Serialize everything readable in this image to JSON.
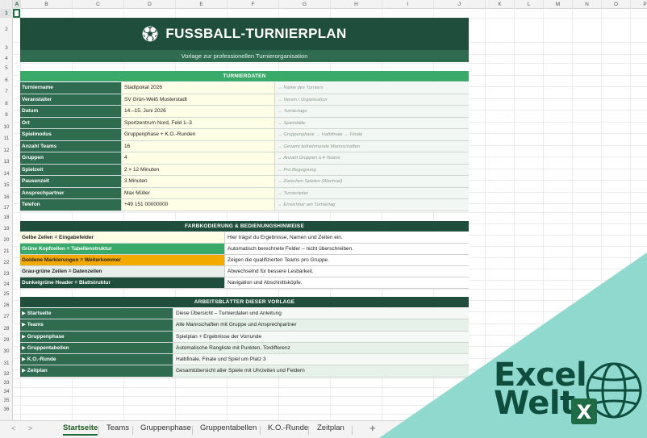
{
  "columns": [
    "A",
    "B",
    "C",
    "D",
    "E",
    "F",
    "G",
    "H",
    "I",
    "J",
    "K",
    "L",
    "M",
    "N",
    "O",
    "P"
  ],
  "rows": [
    "1",
    "2",
    "3",
    "4",
    "5",
    "6",
    "7",
    "8",
    "9",
    "10",
    "11",
    "12",
    "13",
    "14",
    "15",
    "16",
    "17",
    "18",
    "19",
    "20",
    "21",
    "22",
    "23",
    "24",
    "25",
    "26",
    "27",
    "28",
    "29",
    "30",
    "31",
    "32",
    "33",
    "34",
    "35",
    "36"
  ],
  "banner": {
    "title": "FUSSBALL-TURNIERPLAN",
    "subtitle": "Vorlage zur professionellen Turnierorganisation"
  },
  "turnierdaten": {
    "header": "TURNIERDATEN",
    "rows": [
      {
        "label": "Turniername",
        "value": "Stadtpokal 2026",
        "note": "→ Name des Turniers"
      },
      {
        "label": "Veranstalter",
        "value": "SV Grün-Weiß Musterstadt",
        "note": "→ Verein / Organisation"
      },
      {
        "label": "Datum",
        "value": "14.–15. Juni 2026",
        "note": "→ Turniertage"
      },
      {
        "label": "Ort",
        "value": "Sportzentrum Nord, Feld 1–3",
        "note": "→ Spielstätte"
      },
      {
        "label": "Spielmodus",
        "value": "Gruppenphase + K.O.-Runden",
        "note": "→ Gruppenphase → Halbfinale → Finale"
      },
      {
        "label": "Anzahl Teams",
        "value": "16",
        "note": "→ Gesamt teilnehmende Mannschaften"
      },
      {
        "label": "Gruppen",
        "value": "4",
        "note": "→ Anzahl Gruppen à 4 Teams"
      },
      {
        "label": "Spielzeit",
        "value": "2 × 12 Minuten",
        "note": "→ Pro Begegnung"
      },
      {
        "label": "Pausenzeit",
        "value": "3 Minuten",
        "note": "→ Zwischen Spielen (Wechsel)"
      },
      {
        "label": "Ansprechpartner",
        "value": "Max Müller",
        "note": "→ Turnierleiter"
      },
      {
        "label": "Telefon",
        "value": "+49 151 00000000",
        "note": "→ Erreichbar am Turniertag"
      }
    ]
  },
  "farbkodierung": {
    "header": "FARBKODIERUNG & BEDIENUNGSHINWEISE",
    "rows": [
      {
        "label": "Gelbe Zellen = Eingabefelder",
        "desc": "Hier trägst du Ergebnisse, Namen und Zeiten ein.",
        "bg": "#fefde6",
        "fg": "#222222"
      },
      {
        "label": "Grüne Kopfzeilen = Tabellenstruktur",
        "desc": "Automatisch berechnete Felder – nicht überschreiben.",
        "bg": "#3aaa6a",
        "fg": "#ffffff"
      },
      {
        "label": "Goldene Markierungen = Weiterkommer",
        "desc": "Zeigen die qualifizierten Teams pro Gruppe.",
        "bg": "#f2a900",
        "fg": "#222222"
      },
      {
        "label": "Grau-grüne Zeilen = Datenzeilen",
        "desc": "Abwechselnd für bessere Lesbarkeit.",
        "bg": "#e6efe9",
        "fg": "#222222"
      },
      {
        "label": "Dunkelgrüne Header = Blattstruktur",
        "desc": "Navigation und Abschnittsköpfe.",
        "bg": "#1f4e3d",
        "fg": "#ffffff"
      }
    ]
  },
  "arbeitsblaetter": {
    "header": "ARBEITSBLÄTTER DIESER VORLAGE",
    "rows": [
      {
        "label": "▶ Startseite",
        "desc": "Diese Übersicht – Turnierdaten und Anleitung"
      },
      {
        "label": "▶ Teams",
        "desc": "Alle Mannschaften mit Gruppe und Ansprechpartner"
      },
      {
        "label": "▶ Gruppenphase",
        "desc": "Spielplan + Ergebnisse der Vorrunde"
      },
      {
        "label": "▶ Gruppentabellen",
        "desc": "Automatische Rangliste mit Punkten, Tordifferenz"
      },
      {
        "label": "▶ K.O.-Runde",
        "desc": "Halbfinale, Finale und Spiel um Platz 3"
      },
      {
        "label": "▶ Zeitplan",
        "desc": "Gesamtübersicht aller Spiele mit Uhrzeiten und Feldern"
      }
    ]
  },
  "tabs": [
    "Startseite",
    "Teams",
    "Gruppenphase",
    "Gruppentabellen",
    "K.O.-Runde",
    "Zeitplan"
  ],
  "tabbar": {
    "prev": "<",
    "next": ">",
    "add": "+"
  },
  "logo": {
    "line1": "Excel",
    "line2": "Welt",
    "badge": "X"
  },
  "colors": {
    "dark_green": "#1f4e3d",
    "mid_green": "#2e6b4f",
    "light_green": "#3aaa6a",
    "input_yellow": "#fefde6",
    "gold": "#f2a900",
    "teal_overlay": "#8fd9cf"
  }
}
